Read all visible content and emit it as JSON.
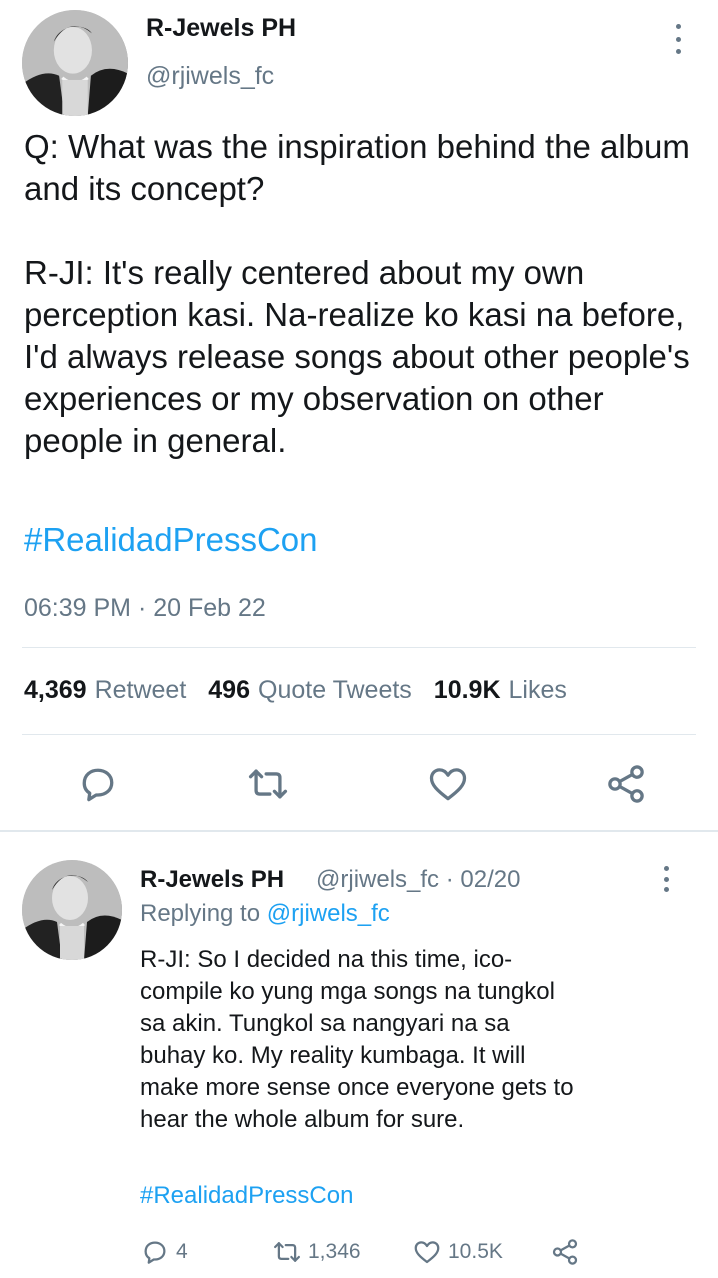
{
  "tweet": {
    "author_name": "R-Jewels PH",
    "author_handle": "@rjiwels_fc",
    "text": "Q: What was the inspiration behind the album and its concept?\n\nR-JI: It's really centered about my own perception kasi. Na-realize ko kasi na before, I'd always release songs about other people's experiences or my observation on other people in general.",
    "hashtag": "#RealidadPressCon",
    "timestamp": "06:39 PM · 20 Feb 22",
    "stats": {
      "retweets": "4,369",
      "retweets_label": "Retweet",
      "quotes": "496",
      "quotes_label": "Quote Tweets",
      "likes": "10.9K",
      "likes_label": "Likes"
    },
    "actions": [
      "reply-icon",
      "retweet-icon",
      "like-icon",
      "share-icon"
    ]
  },
  "reply": {
    "author_name": "R-Jewels PH",
    "meta": "@rjiwels_fc · 02/20",
    "replying_prefix": "Replying to",
    "replying_to": "@rjiwels_fc",
    "text": "R-JI: So I decided na this time, ico-\ncompile ko yung mga songs na tungkol\nsa akin. Tungkol sa nangyari na sa\nbuhay ko. My reality kumbaga. It will\nmake more sense once everyone gets to\nhear the whole album for sure.",
    "hashtag": "#RealidadPressCon",
    "reply_count": "4",
    "retweet_count": "1,346",
    "like_count": "10.5K"
  },
  "colors": {
    "accent": "#1da1f2",
    "secondary_text": "#657786",
    "divider": "#e1e8ed"
  }
}
